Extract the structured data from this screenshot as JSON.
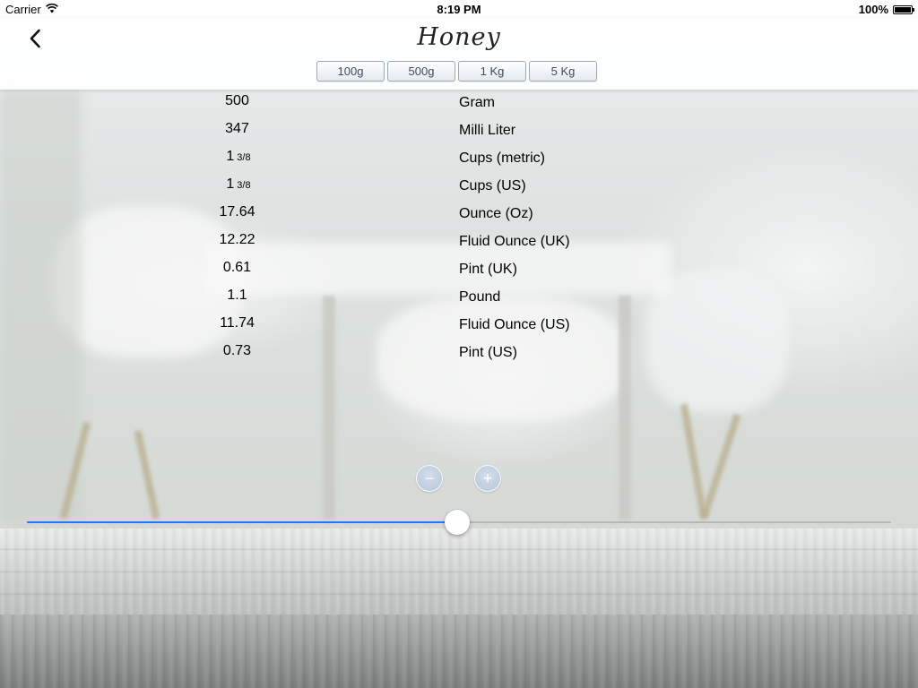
{
  "status_bar": {
    "carrier": "Carrier",
    "time": "8:19 PM",
    "battery": "100%",
    "battery_level": 1.0
  },
  "header": {
    "title": "Honey",
    "back_icon": "chevron-left-icon",
    "amount_buttons": [
      {
        "label": "100g"
      },
      {
        "label": "500g"
      },
      {
        "label": "1 Kg"
      },
      {
        "label": "5 Kg"
      }
    ]
  },
  "conversions": [
    {
      "value": "500",
      "fraction": "",
      "unit": "Gram"
    },
    {
      "value": "347",
      "fraction": "",
      "unit": "Milli Liter"
    },
    {
      "value": "1",
      "fraction": "3/8",
      "unit": "Cups (metric)"
    },
    {
      "value": "1",
      "fraction": "3/8",
      "unit": "Cups (US)"
    },
    {
      "value": "17.64",
      "fraction": "",
      "unit": "Ounce (Oz)"
    },
    {
      "value": "12.22",
      "fraction": "",
      "unit": "Fluid Ounce (UK)"
    },
    {
      "value": "0.61",
      "fraction": "",
      "unit": "Pint (UK)"
    },
    {
      "value": "1.1",
      "fraction": "",
      "unit": "Pound"
    },
    {
      "value": "11.74",
      "fraction": "",
      "unit": "Fluid Ounce (US)"
    },
    {
      "value": "0.73",
      "fraction": "",
      "unit": "Pint (US)"
    }
  ],
  "controls": {
    "decrement_symbol": "−",
    "increment_symbol": "+",
    "slider_fraction": 0.498
  },
  "colors": {
    "accent": "#1a7cf0",
    "button_text": "#3c4b5e"
  }
}
